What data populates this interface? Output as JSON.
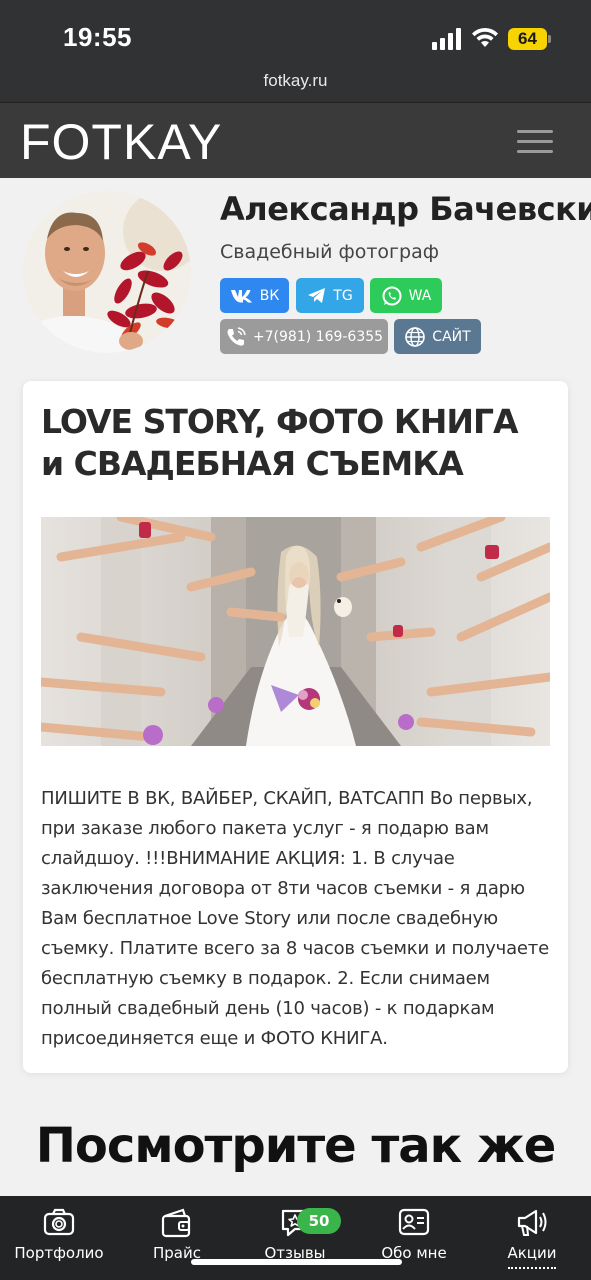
{
  "status": {
    "time": "19:55",
    "battery": "64"
  },
  "browser": {
    "url": "fotkay.ru"
  },
  "header": {
    "logo": "FOTKAY"
  },
  "profile": {
    "name": "Александр Бачевский",
    "role": "Свадебный фотограф",
    "buttons": {
      "vk": "ВК",
      "tg": "TG",
      "wa": "WA",
      "phone": "+7(981) 169-6355",
      "site": "САЙТ"
    }
  },
  "article": {
    "title": "LOVE STORY, ФОТО КНИГА и СВАДЕБНАЯ СЪЕМКА",
    "body": "ПИШИТЕ В ВК, ВАЙБЕР, СКАЙП, ВАТСАПП Во первых, при заказе любого пакета услуг - я подарю вам слайдшоу. !!!ВНИМАНИЕ АКЦИЯ: 1. В случае заключения договора от 8ти часов съемки - я дарю Вам бесплатное Love Story или после свадебную съемку. Платите всего за 8 часов съемки и получаете бесплатную съемку в подарок. 2. Если снимаем полный свадебный день (10 часов) - к подаркам присоединяется еще и ФОТО КНИГА."
  },
  "see_also": "Посмотрите так же",
  "bottom_nav": {
    "items": [
      {
        "label": "Портфолио",
        "icon": "camera-icon"
      },
      {
        "label": "Прайс",
        "icon": "wallet-icon"
      },
      {
        "label": "Отзывы",
        "icon": "review-star-icon"
      },
      {
        "label": "Обо мне",
        "icon": "id-card-icon"
      },
      {
        "label": "Акции",
        "icon": "megaphone-icon"
      }
    ],
    "reviews_badge": "50",
    "active": "Акции"
  },
  "colors": {
    "vk": "#2f88f0",
    "tg": "#32a6e6",
    "wa": "#2dcc5a",
    "phone": "#9b9b9b",
    "site": "#5b7892",
    "badge": "#39b54a",
    "header": "#3a3a3a"
  }
}
